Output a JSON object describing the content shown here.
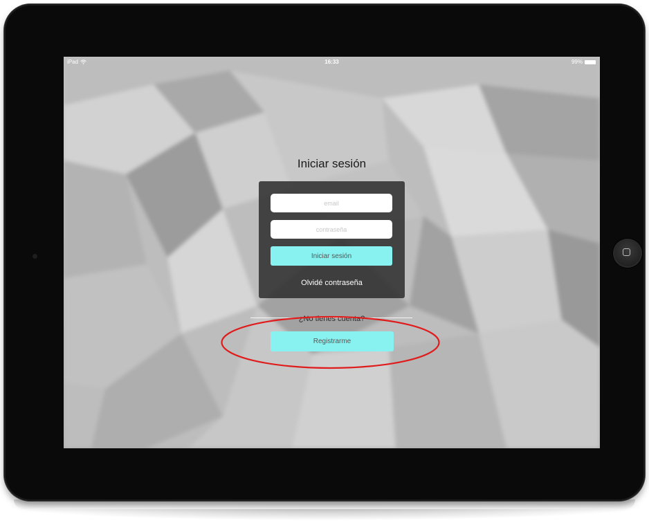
{
  "status_bar": {
    "device": "iPad",
    "time": "16:33",
    "battery": "99%",
    "battery_level": 0.99
  },
  "login": {
    "title": "Iniciar sesión",
    "email_placeholder": "email",
    "password_placeholder": "contraseña",
    "submit_label": "Iniciar sesión",
    "forgot_label": "Olvidé contraseña"
  },
  "register": {
    "prompt": "¿No tienes cuenta?",
    "button_label": "Registrarme"
  },
  "colors": {
    "accent_button": "#88f2f0",
    "panel_background": "#2d2d2d",
    "highlight_annotation": "#e01b1b"
  },
  "icons": [
    "wifi-icon",
    "battery-icon",
    "home-button-icon",
    "camera-icon"
  ]
}
